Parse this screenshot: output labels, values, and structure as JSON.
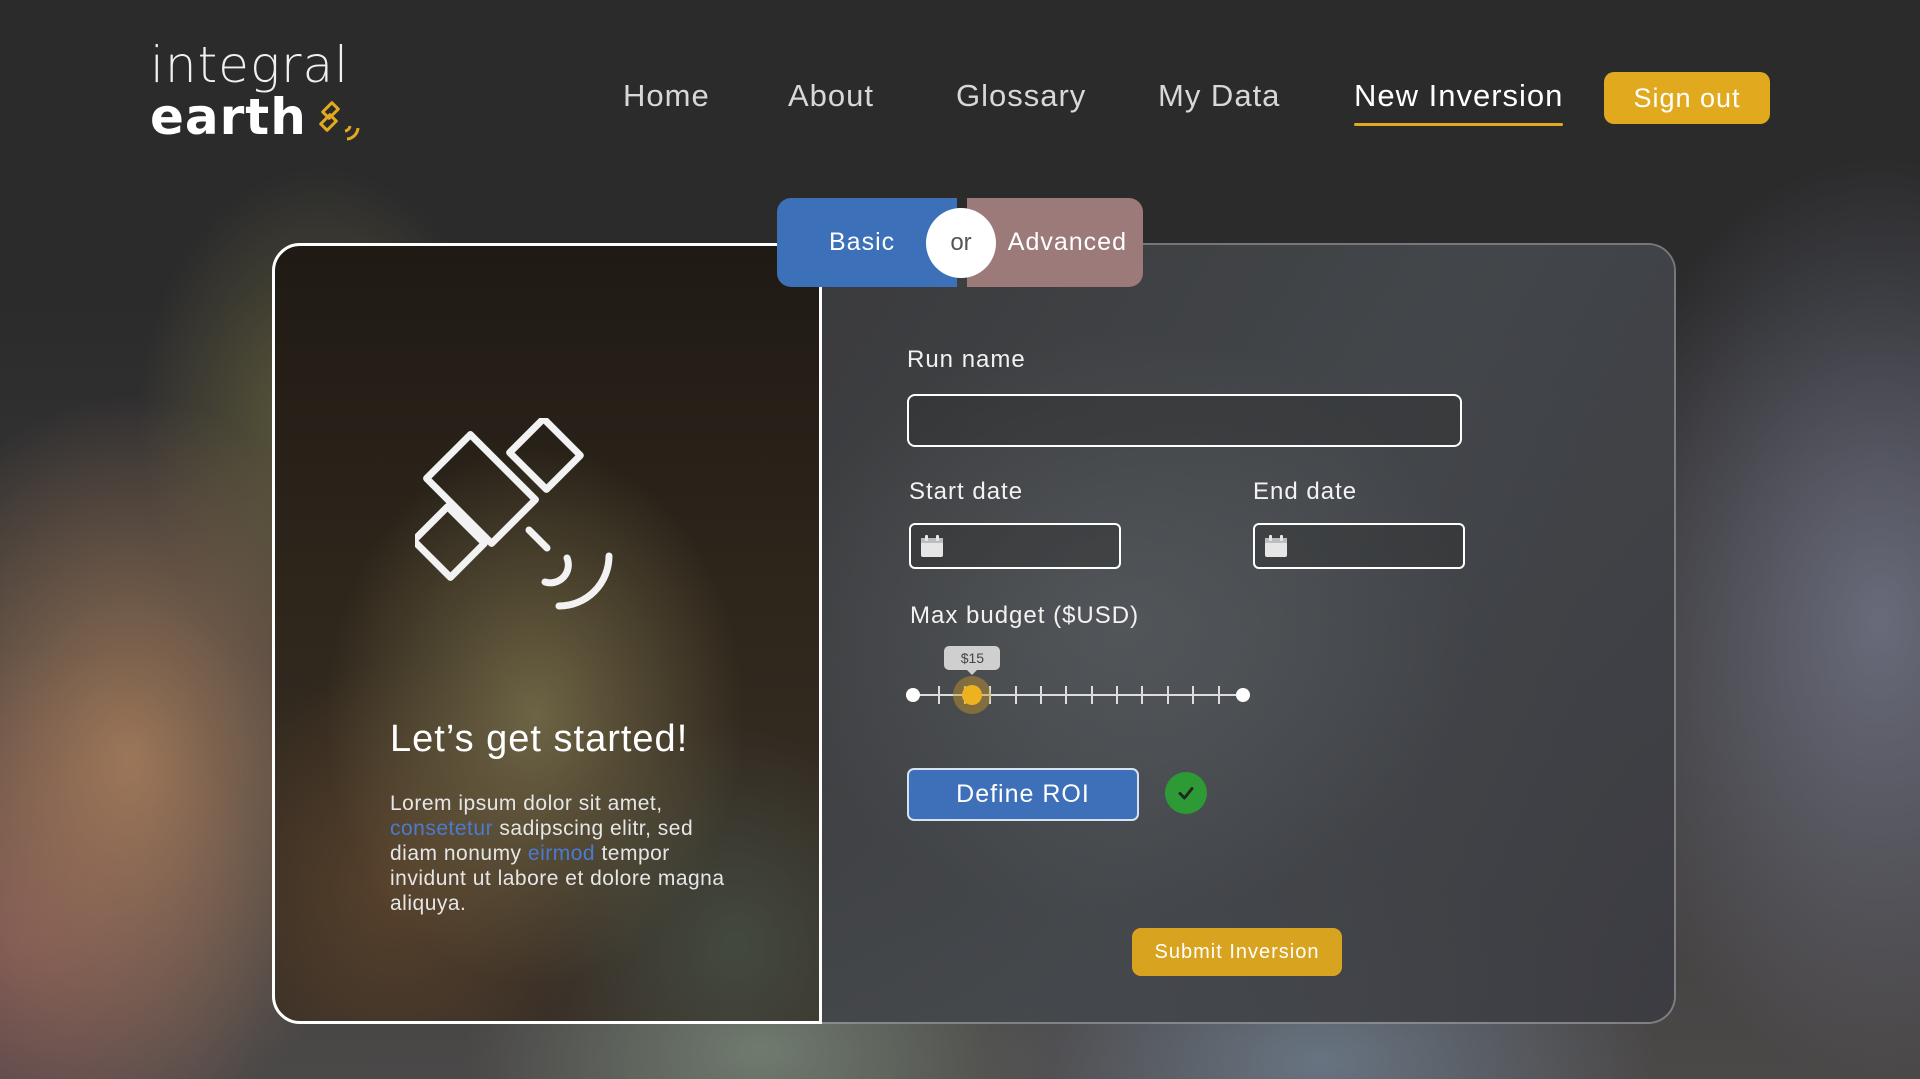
{
  "brand": {
    "line1": "integral",
    "line2": "earth",
    "accent_color": "#e4aa1e",
    "mark_icon": "satellite-icon"
  },
  "nav": {
    "items": [
      {
        "label": "Home",
        "active": false
      },
      {
        "label": "About",
        "active": false
      },
      {
        "label": "Glossary",
        "active": false
      },
      {
        "label": "My Data",
        "active": false
      },
      {
        "label": "New Inversion",
        "active": true
      }
    ],
    "sign_out": "Sign out"
  },
  "mode_toggle": {
    "basic": "Basic",
    "or": "or",
    "advanced": "Advanced",
    "selected": "Basic"
  },
  "intro": {
    "illustration_icon": "satellite-icon",
    "heading": "Let’s get started!",
    "body_1": "Lorem ipsum dolor sit amet,",
    "link_1": "consetetur",
    "body_2": " sadipscing elitr, sed diam nonumy ",
    "link_2": "eirmod",
    "body_3": " tempor invidunt ut labore et dolore magna aliquya."
  },
  "form": {
    "run_name": {
      "label": "Run name",
      "value": ""
    },
    "start_date": {
      "label": "Start date",
      "value": "",
      "icon": "calendar-icon"
    },
    "end_date": {
      "label": "End date",
      "value": "",
      "icon": "calendar-icon"
    },
    "budget": {
      "label": "Max budget ($USD)",
      "value_label": "$15",
      "ticks": 12,
      "position_fraction": 0.18
    },
    "roi_button": "Define ROI",
    "roi_status_icon": "check-icon",
    "submit": "Submit Inversion"
  },
  "colors": {
    "primary_blue": "#3c70b8",
    "advanced_rose": "#9b7a79",
    "gold": "#e0a91e",
    "success_green": "#2e9a36",
    "link_blue": "#4a7bcf"
  }
}
